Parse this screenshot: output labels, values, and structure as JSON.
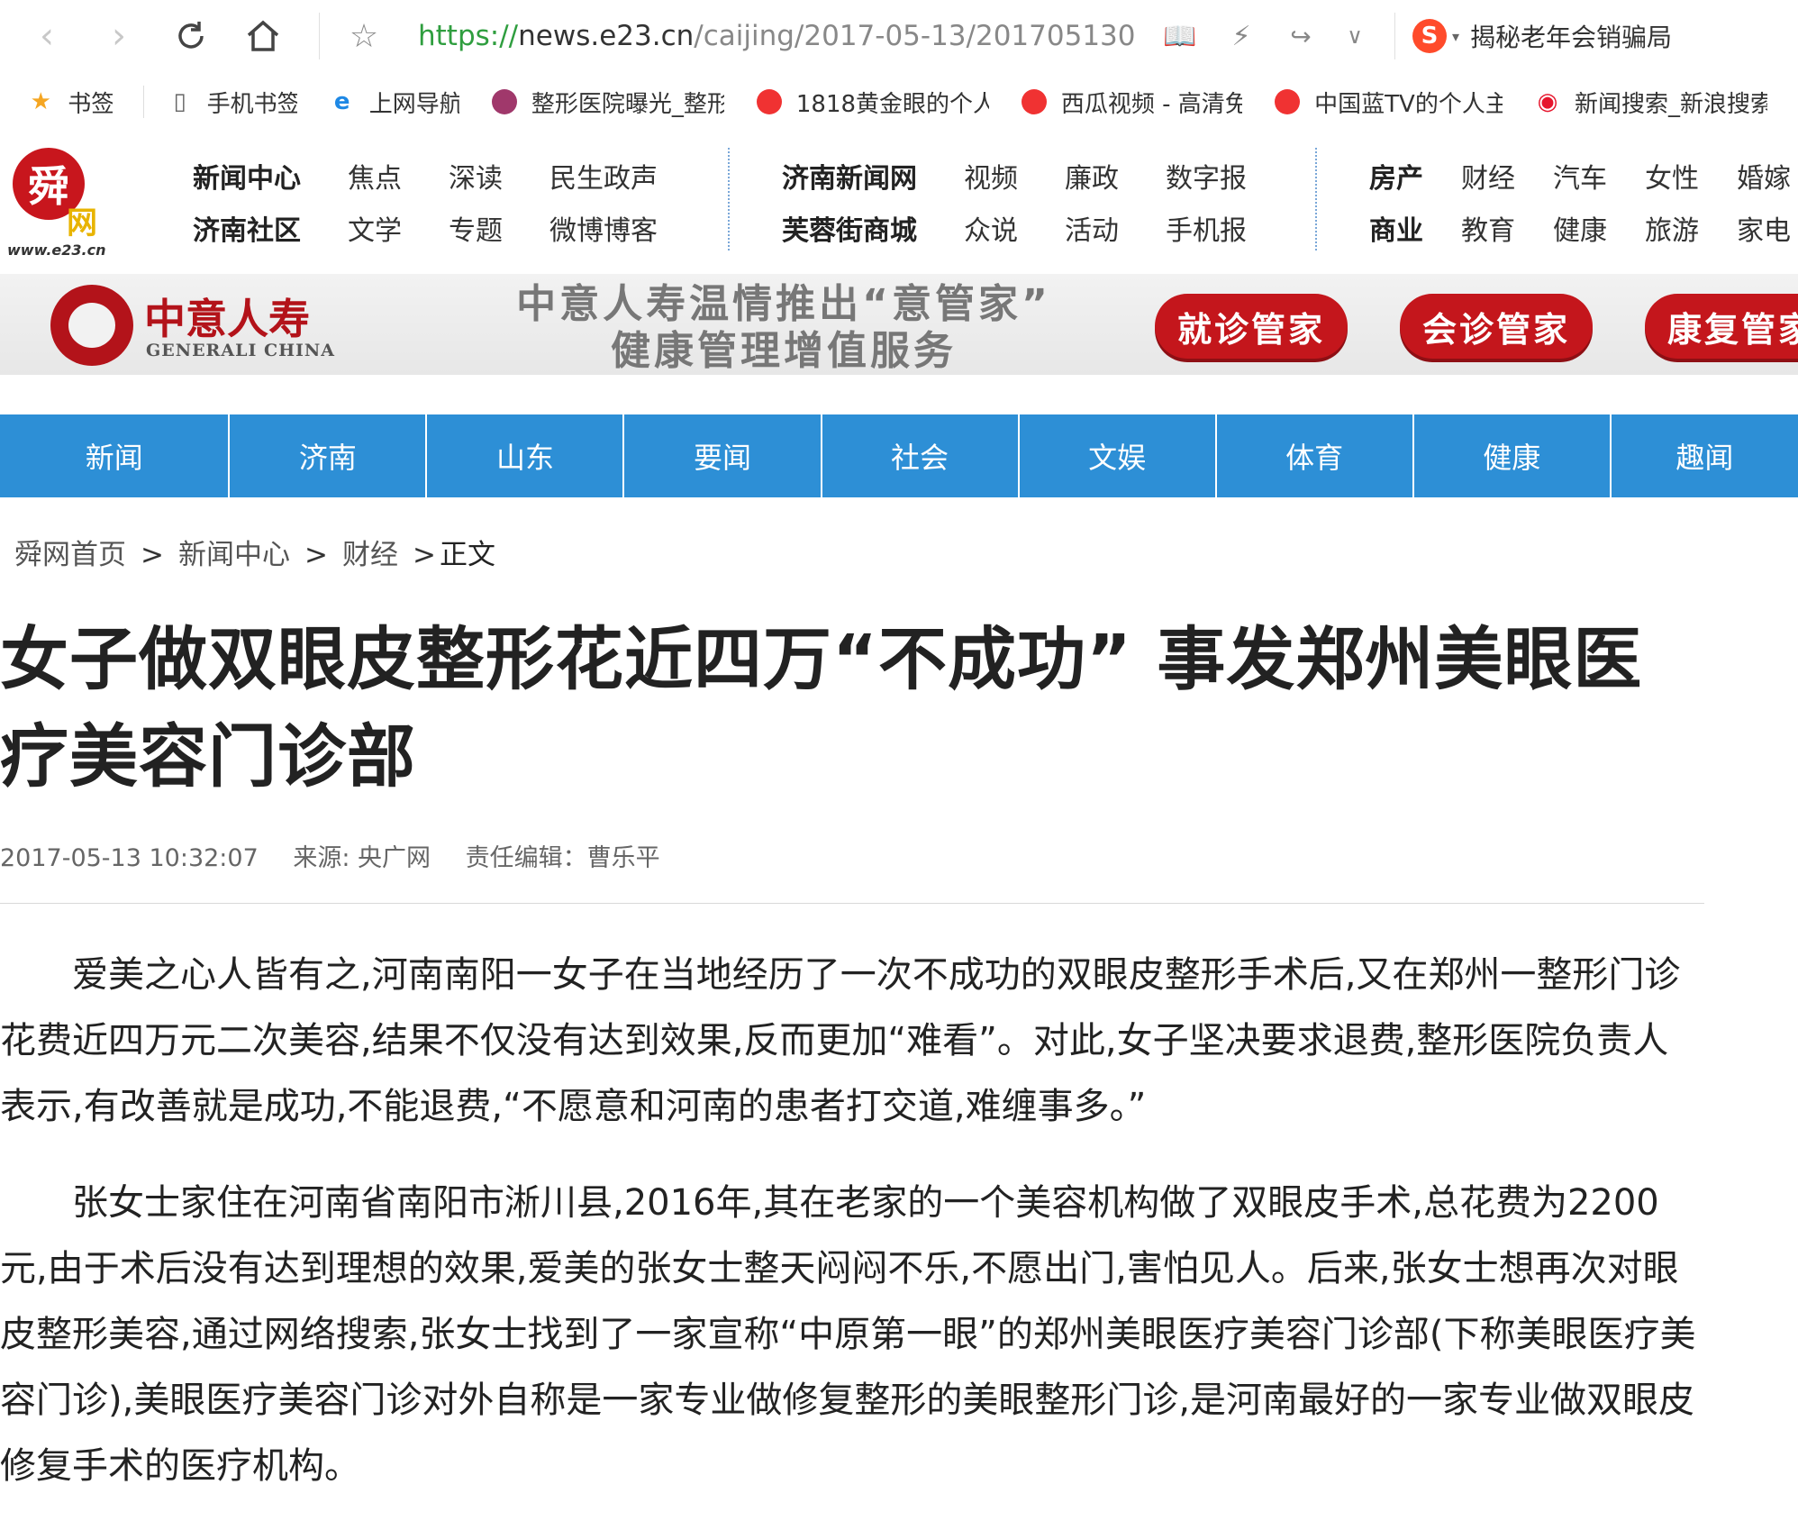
{
  "browser": {
    "url_scheme": "https://",
    "url_host": "news.e23.cn",
    "url_path": "/caijing/2017-05-13/201705130",
    "search_text": "揭秘老年会销骗局"
  },
  "bookmarks": [
    {
      "label": "书签",
      "icon": "star-icon"
    },
    {
      "label": "手机书签",
      "icon": "phone-icon"
    },
    {
      "label": "上网导航",
      "icon": "ie-icon"
    },
    {
      "label": "整形医院曝光_整形",
      "icon": "clinic-icon"
    },
    {
      "label": "1818黄金眼的个人",
      "icon": "video-icon"
    },
    {
      "label": "西瓜视频 - 高清免",
      "icon": "video-icon"
    },
    {
      "label": "中国蓝TV的个人主",
      "icon": "video-icon"
    },
    {
      "label": "新闻搜索_新浪搜索",
      "icon": "weibo-icon"
    }
  ],
  "site": {
    "logo_char": "舜",
    "logo_wang": "网",
    "logo_domain": "www.e23.cn",
    "nav_group1": [
      "新闻中心",
      "济南社区",
      "焦点",
      "文学",
      "深读",
      "专题",
      "民生政声",
      "微博博客"
    ],
    "nav_group2": [
      "济南新闻网",
      "芙蓉街商城",
      "视频",
      "众说",
      "廉政",
      "活动",
      "数字报",
      "手机报"
    ],
    "nav_group3": [
      "房产",
      "商业",
      "财经",
      "教育",
      "汽车",
      "健康",
      "女性",
      "旅游",
      "婚嫁",
      "家电"
    ]
  },
  "ad": {
    "brand": "中意人寿",
    "brand_en": "GENERALI CHINA",
    "line1": "中意人寿温情推出“意管家”",
    "line2": "健康管理增值服务",
    "buttons": [
      "就诊管家",
      "会诊管家",
      "康复管家"
    ]
  },
  "channels": [
    "新闻",
    "济南",
    "山东",
    "要闻",
    "社会",
    "文娱",
    "体育",
    "健康",
    "趣闻"
  ],
  "breadcrumb": {
    "items": [
      "舜网首页",
      "新闻中心",
      "财经"
    ],
    "current": "正文",
    "sep": ">"
  },
  "article": {
    "title": "女子做双眼皮整形花近四万“不成功” 事发郑州美眼医疗美容门诊部",
    "time": "2017-05-13 10:32:07",
    "source": "来源: 央广网",
    "editor": "责任编辑：曹乐平",
    "paragraphs": [
      "爱美之心人皆有之,河南南阳一女子在当地经历了一次不成功的双眼皮整形手术后,又在郑州一整形门诊花费近四万元二次美容,结果不仅没有达到效果,反而更加“难看”。对此,女子坚决要求退费,整形医院负责人表示,有改善就是成功,不能退费,“不愿意和河南的患者打交道,难缠事多。”",
      "张女士家住在河南省南阳市淅川县,2016年,其在老家的一个美容机构做了双眼皮手术,总花费为2200元,由于术后没有达到理想的效果,爱美的张女士整天闷闷不乐,不愿出门,害怕见人。后来,张女士想再次对眼皮整形美容,通过网络搜索,张女士找到了一家宣称“中原第一眼”的郑州美眼医疗美容门诊部(下称美眼医疗美容门诊),美眼医疗美容门诊对外自称是一家专业做修复整形的美眼整形门诊,是河南最好的一家专业做双眼皮修复手术的医疗机构。"
    ]
  }
}
